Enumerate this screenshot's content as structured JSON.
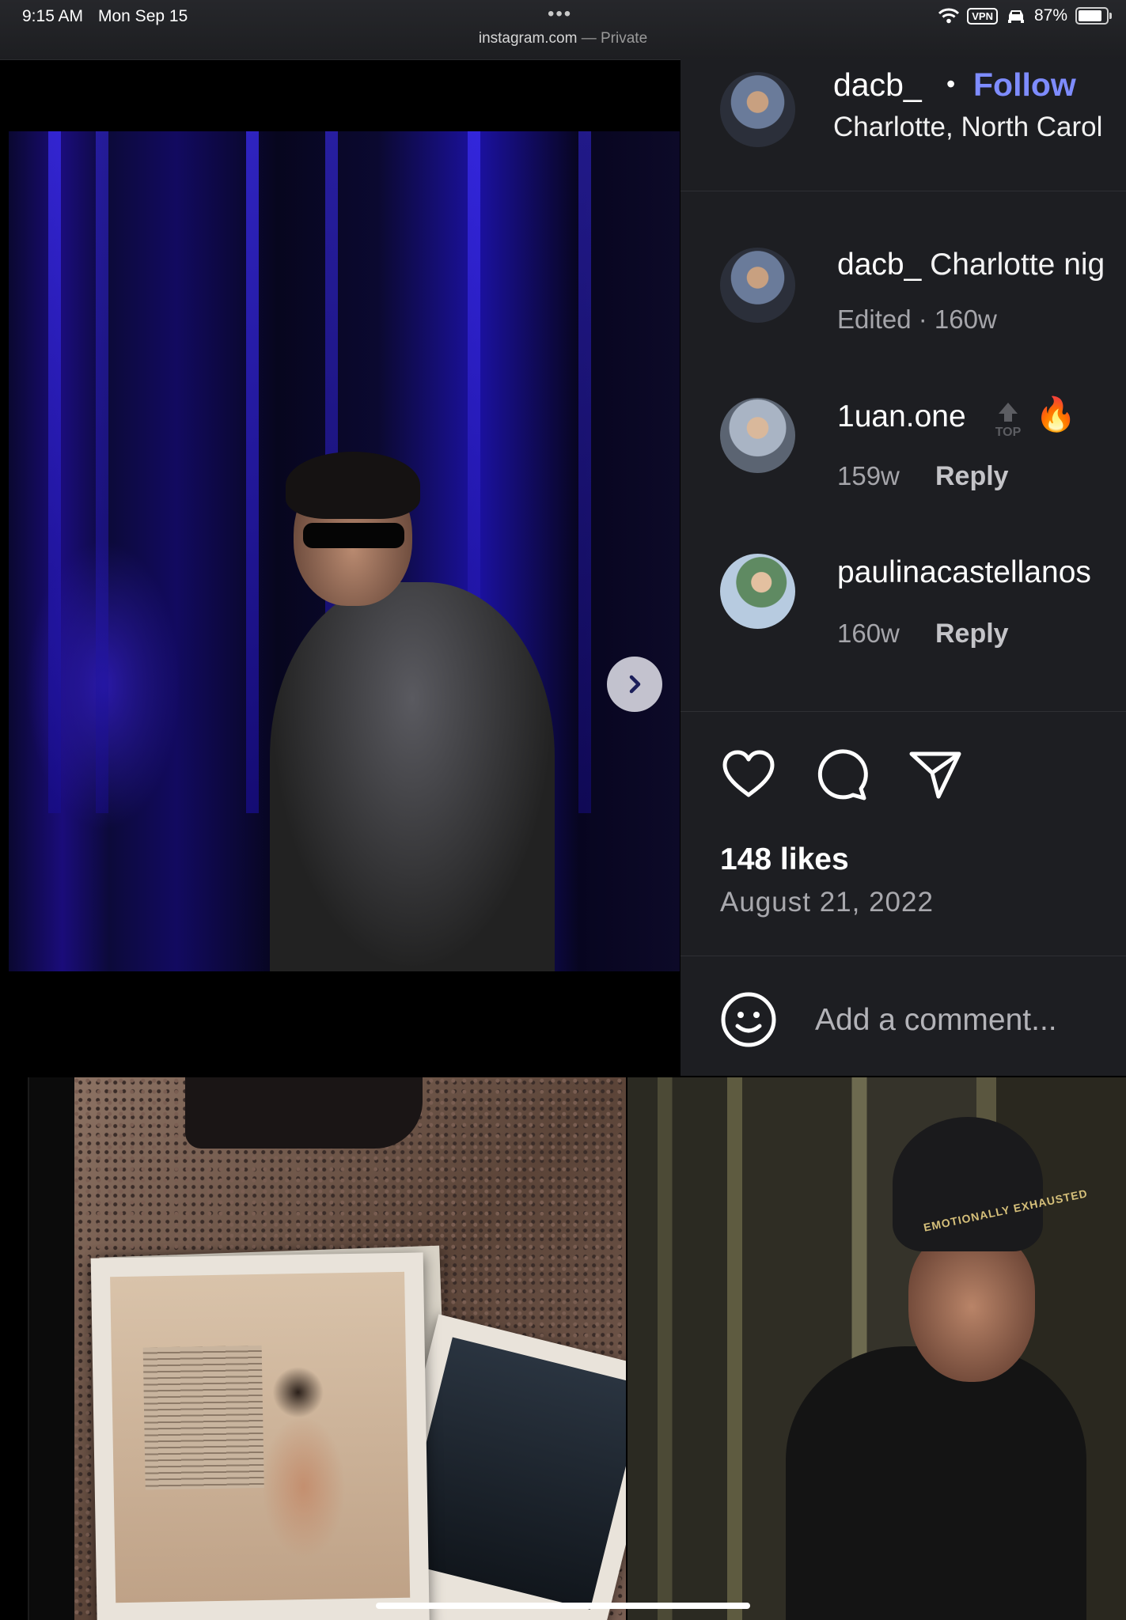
{
  "status_bar": {
    "time": "9:15 AM",
    "date": "Mon Sep 15",
    "dots": "•••",
    "domain": "instagram.com",
    "mode": "— Private",
    "vpn": "VPN",
    "battery": "87%"
  },
  "post": {
    "carousel_dots": 5,
    "active_dot": 0,
    "header": {
      "username": "dacb_",
      "separator": "•",
      "follow_label": "Follow",
      "location": "Charlotte, North Carol"
    },
    "caption": {
      "username": "dacb_",
      "text": "Charlotte nig",
      "meta": "Edited · 160w"
    },
    "comments": [
      {
        "username": "1uan.one",
        "badge": "TOP",
        "emoji": "🔥",
        "age": "159w",
        "reply_label": "Reply"
      },
      {
        "username": "paulinacastellanos",
        "age": "160w",
        "reply_label": "Reply"
      }
    ],
    "likes": "148 likes",
    "date": "August 21, 2022",
    "comment_placeholder": "Add a comment..."
  },
  "grid": {
    "beanie_text": "EMOTIONALLY EXHAUSTED"
  },
  "colors": {
    "follow": "#7e8cff",
    "panel_bg": "#1d1e22",
    "page_bg": "#000000"
  },
  "icons": [
    "wifi-icon",
    "vpn-icon",
    "car-icon",
    "battery-icon",
    "chevron-right-icon",
    "heart-icon",
    "comment-icon",
    "share-icon",
    "smiley-icon",
    "top-badge-icon"
  ]
}
